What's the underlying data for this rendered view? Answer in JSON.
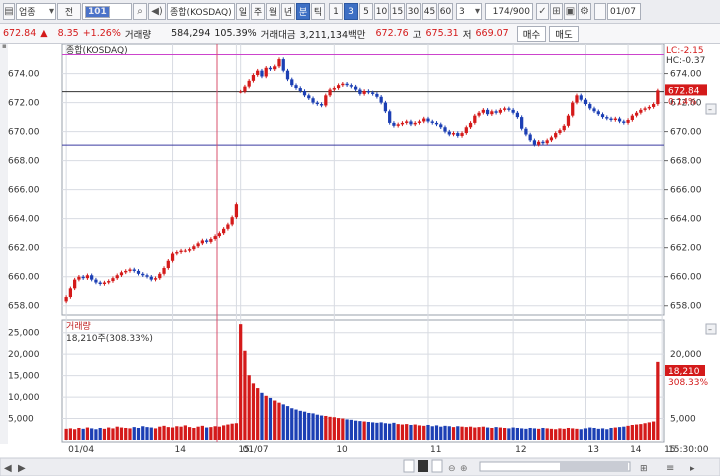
{
  "toolbar": {
    "market": "업종",
    "mode": "전",
    "code": "101",
    "name": "종합(KOSDAQ)",
    "periods": [
      "일",
      "주",
      "월",
      "년",
      "분",
      "틱"
    ],
    "active_period": "분",
    "intervals": [
      "1",
      "3",
      "5",
      "10",
      "15",
      "30",
      "45",
      "60"
    ],
    "active_interval": "3",
    "interval_value": "3",
    "count": "174",
    "total": "/900",
    "date": "01/07"
  },
  "quote": {
    "price": "672.84",
    "change_arrow": "▲",
    "change": "8.35",
    "change_pct": "+1.26%",
    "volume_label": "거래량",
    "volume": "584,294",
    "volume_ratio": "105.39%",
    "amount_label": "거래대금",
    "amount": "3,211,134백만",
    "open": "672.76",
    "high_label": "고",
    "high": "675.31",
    "low_label": "저",
    "low": "669.07",
    "buy_label": "매수",
    "sell_label": "매도"
  },
  "chart_data": [
    {
      "type": "candlestick",
      "title": "종합(KOSDAQ)",
      "ylim": [
        657.5,
        675.9
      ],
      "yticks": [
        "674.00",
        "672.00",
        "670.00",
        "668.00",
        "666.00",
        "664.00",
        "662.00",
        "660.00",
        "658.00"
      ],
      "ytick_values": [
        674,
        672,
        670,
        668,
        666,
        664,
        662,
        660,
        658
      ],
      "right_labels": {
        "lc": "LC:-2.15",
        "hc": "HC:-0.37",
        "price_tag": "672.84",
        "pct_tag": "0.14%"
      },
      "hlines": [
        {
          "name": "prev-high",
          "value": 675.31,
          "color": "#cc44cc"
        },
        {
          "name": "open-line",
          "value": 672.76,
          "color": "#333333"
        },
        {
          "name": "prev-low",
          "value": 669.07,
          "color": "#3a3aa0"
        }
      ],
      "closes": [
        658.6,
        659.2,
        659.8,
        660.0,
        659.9,
        660.1,
        659.8,
        659.6,
        659.5,
        659.6,
        659.7,
        659.9,
        660.1,
        660.3,
        660.4,
        660.5,
        660.4,
        660.2,
        660.1,
        660.0,
        659.8,
        659.9,
        660.2,
        660.6,
        661.1,
        661.6,
        661.7,
        661.8,
        661.8,
        661.9,
        662.1,
        662.3,
        662.5,
        662.4,
        662.6,
        662.8,
        663.0,
        663.3,
        663.6,
        664.1,
        665.0,
        672.76,
        673.1,
        673.5,
        673.9,
        674.2,
        673.8,
        674.4,
        674.3,
        674.5,
        675.0,
        674.2,
        673.6,
        673.2,
        673.0,
        672.8,
        672.5,
        672.3,
        672.0,
        671.9,
        671.8,
        672.5,
        672.9,
        673.0,
        673.2,
        673.3,
        673.2,
        673.1,
        672.9,
        672.6,
        672.8,
        672.7,
        672.6,
        672.4,
        672.0,
        671.4,
        670.6,
        670.4,
        670.5,
        670.6,
        670.7,
        670.5,
        670.6,
        670.7,
        670.9,
        670.7,
        670.6,
        670.5,
        670.3,
        670.0,
        669.8,
        669.9,
        669.7,
        669.9,
        670.3,
        670.6,
        671.1,
        671.3,
        671.5,
        671.2,
        671.4,
        671.3,
        671.5,
        671.6,
        671.5,
        671.3,
        671.0,
        670.2,
        669.8,
        669.4,
        669.1,
        669.3,
        669.2,
        669.4,
        669.6,
        669.9,
        670.1,
        670.4,
        671.1,
        672.0,
        672.5,
        672.2,
        671.9,
        671.6,
        671.4,
        671.2,
        671.0,
        670.9,
        670.8,
        670.9,
        670.7,
        670.6,
        670.8,
        671.1,
        671.3,
        671.5,
        671.6,
        671.7,
        671.9,
        672.84
      ],
      "x_ticks": [
        "01/04",
        "14",
        "15",
        "01/07",
        "10",
        "11",
        "12",
        "13",
        "14",
        "15"
      ],
      "time_label": "15:30:00"
    },
    {
      "type": "bar",
      "title": "거래량",
      "subtitle": "18,210주(308.33%)",
      "ylim": [
        0,
        27500
      ],
      "yticks": [
        "25,000",
        "20,000",
        "15,000",
        "10,000",
        "5,000"
      ],
      "ytick_values": [
        25000,
        20000,
        15000,
        10000,
        5000
      ],
      "right_labels": {
        "vol_a": "20,000",
        "vol_tag": "18,210",
        "pct_tag": "308.33%",
        "vol_b": "15,000",
        "vol_c": "10,000",
        "vol_d": "5,000"
      },
      "values": [
        2600,
        2700,
        2500,
        2800,
        2600,
        2900,
        2700,
        2500,
        2800,
        2600,
        2900,
        2700,
        3100,
        2900,
        2800,
        2700,
        3000,
        2800,
        3200,
        3000,
        2900,
        2700,
        3100,
        3300,
        3000,
        2900,
        3200,
        3100,
        3400,
        3000,
        2800,
        3100,
        3300,
        2900,
        3000,
        3200,
        3100,
        3400,
        3600,
        3800,
        3900,
        27000,
        20800,
        15100,
        13200,
        12100,
        11000,
        10300,
        9800,
        9200,
        8700,
        8300,
        7900,
        7400,
        7100,
        6800,
        6600,
        6300,
        6200,
        5900,
        5700,
        5600,
        5400,
        5300,
        5100,
        5000,
        4800,
        4700,
        4500,
        4400,
        4300,
        4200,
        4100,
        4000,
        4100,
        3900,
        3800,
        4000,
        3700,
        3600,
        3700,
        3500,
        3600,
        3400,
        3300,
        3500,
        3200,
        3400,
        3100,
        3300,
        3200,
        3000,
        3200,
        3100,
        3000,
        3100,
        2900,
        3000,
        3100,
        2900,
        2800,
        3000,
        2900,
        2800,
        2700,
        2900,
        2800,
        2700,
        2600,
        2800,
        2700,
        2600,
        2800,
        2700,
        2600,
        2500,
        2700,
        2600,
        2800,
        2700,
        2600,
        2500,
        2700,
        2900,
        2800,
        2600,
        2700,
        2500,
        2800,
        2900,
        3000,
        3100,
        3300,
        3500,
        3600,
        3700,
        3900,
        4100,
        4300,
        18210
      ]
    }
  ],
  "colors": {
    "up": "#d41a1a",
    "down": "#1c3fb4",
    "grid": "#d8dbe2",
    "axis": "#666666"
  }
}
